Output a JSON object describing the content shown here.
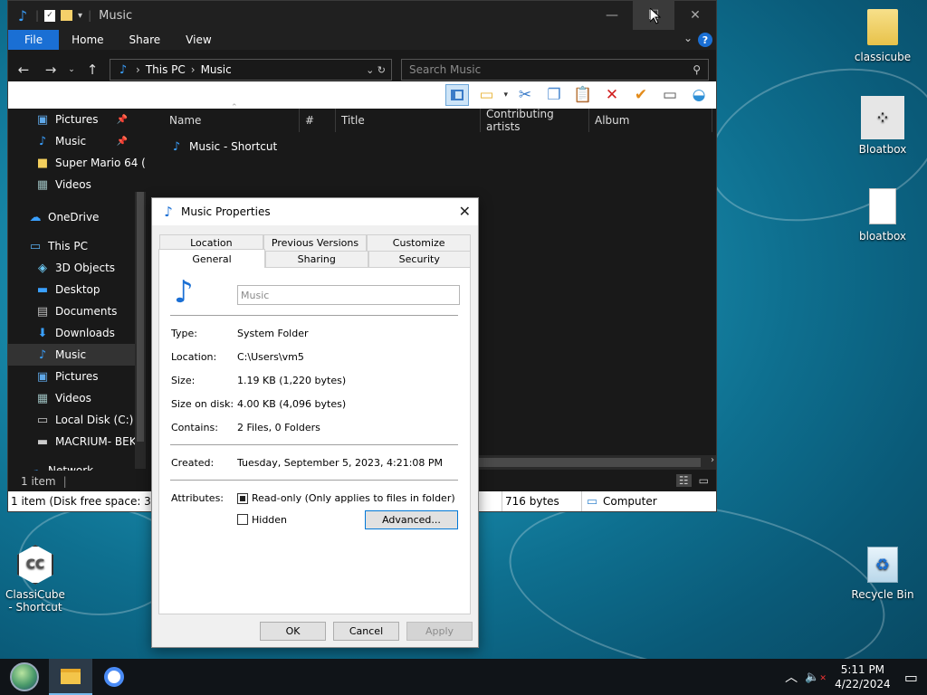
{
  "explorer": {
    "title": "Music",
    "ribbon_tabs": [
      "File",
      "Home",
      "Share",
      "View"
    ],
    "address_parts": [
      "This PC",
      "Music"
    ],
    "search_placeholder": "Search Music",
    "nav_items": [
      {
        "label": "Pictures",
        "icon": "pictures-icon",
        "pinned": true
      },
      {
        "label": "Music",
        "icon": "music-note-icon",
        "pinned": true
      },
      {
        "label": "Super Mario 64 (",
        "icon": "folder-icon",
        "pinned": false
      },
      {
        "label": "Videos",
        "icon": "videos-icon",
        "pinned": false
      },
      {
        "label": "OneDrive",
        "icon": "cloud-icon",
        "pinned": false,
        "top": true
      },
      {
        "label": "This PC",
        "icon": "computer-icon",
        "pinned": false,
        "top": true
      },
      {
        "label": "3D Objects",
        "icon": "cube-icon",
        "pinned": false
      },
      {
        "label": "Desktop",
        "icon": "desktop-icon",
        "pinned": false
      },
      {
        "label": "Documents",
        "icon": "documents-icon",
        "pinned": false
      },
      {
        "label": "Downloads",
        "icon": "download-icon",
        "pinned": false
      },
      {
        "label": "Music",
        "icon": "music-note-icon",
        "pinned": false,
        "selected": true
      },
      {
        "label": "Pictures",
        "icon": "pictures-icon",
        "pinned": false
      },
      {
        "label": "Videos",
        "icon": "videos-icon",
        "pinned": false
      },
      {
        "label": "Local Disk (C:)",
        "icon": "disk-icon",
        "pinned": false
      },
      {
        "label": "MACRIUM- BEK",
        "icon": "drive-icon",
        "pinned": false
      },
      {
        "label": "Network",
        "icon": "network-icon",
        "pinned": false,
        "top": true
      }
    ],
    "columns": [
      "Name",
      "#",
      "Title",
      "Contributing artists",
      "Album"
    ],
    "files": [
      "Music - Shortcut"
    ],
    "status_count": "1 item",
    "bottom_status": {
      "disk_free": "1 item (Disk free space: 37.2 GB)",
      "size": "716 bytes",
      "location": "Computer"
    }
  },
  "dialog": {
    "title": "Music Properties",
    "tabs_row1": [
      "Location",
      "Previous Versions",
      "Customize"
    ],
    "tabs_row2": [
      "General",
      "Sharing",
      "Security"
    ],
    "name_value": "Music",
    "props": [
      {
        "k": "Type:",
        "v": "System Folder"
      },
      {
        "k": "Location:",
        "v": "C:\\Users\\vm5"
      },
      {
        "k": "Size:",
        "v": "1.19 KB (1,220 bytes)"
      },
      {
        "k": "Size on disk:",
        "v": "4.00 KB (4,096 bytes)"
      },
      {
        "k": "Contains:",
        "v": "2 Files, 0 Folders"
      }
    ],
    "created_label": "Created:",
    "created_value": "Tuesday, September 5, 2023, 4:21:08 PM",
    "attributes_label": "Attributes:",
    "readonly_label": "Read-only (Only applies to files in folder)",
    "hidden_label": "Hidden",
    "advanced_label": "Advanced...",
    "ok_label": "OK",
    "cancel_label": "Cancel",
    "apply_label": "Apply"
  },
  "desktop_icons": {
    "classicube": "classicube",
    "bloatbox_app": "Bloatbox",
    "bloatbox_file": "bloatbox",
    "classicube_shortcut": "ClassiCube - Shortcut",
    "recycle_bin": "Recycle Bin"
  },
  "taskbar": {
    "time": "5:11 PM",
    "date": "4/22/2024"
  },
  "colors": {
    "accent": "#1a6fd4",
    "explorer_bg": "#191919",
    "dialog_bg": "#f0f0f0"
  }
}
